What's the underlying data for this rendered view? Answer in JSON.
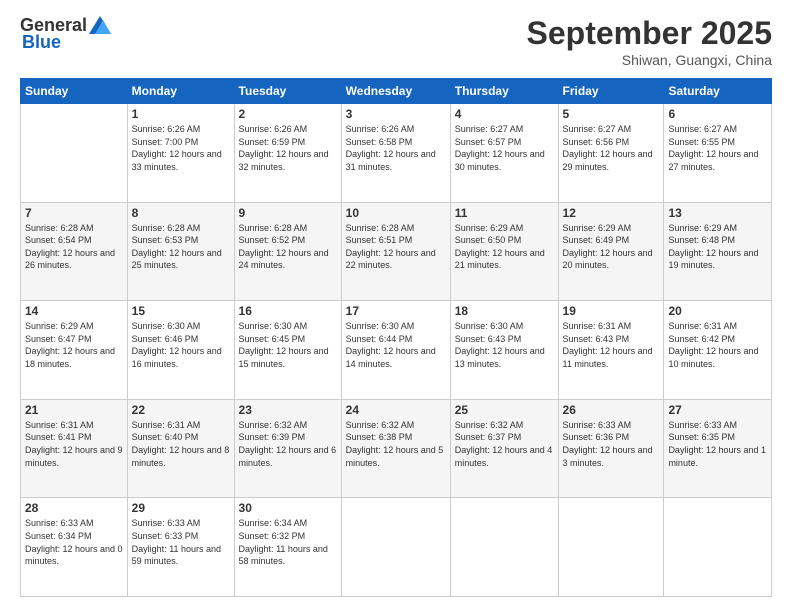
{
  "header": {
    "logo": {
      "text1": "General",
      "text2": "Blue"
    },
    "title": "September 2025",
    "location": "Shiwan, Guangxi, China"
  },
  "weekdays": [
    "Sunday",
    "Monday",
    "Tuesday",
    "Wednesday",
    "Thursday",
    "Friday",
    "Saturday"
  ],
  "weeks": [
    [
      {
        "day": "",
        "sunrise": "",
        "sunset": "",
        "daylight": ""
      },
      {
        "day": "1",
        "sunrise": "Sunrise: 6:26 AM",
        "sunset": "Sunset: 7:00 PM",
        "daylight": "Daylight: 12 hours and 33 minutes."
      },
      {
        "day": "2",
        "sunrise": "Sunrise: 6:26 AM",
        "sunset": "Sunset: 6:59 PM",
        "daylight": "Daylight: 12 hours and 32 minutes."
      },
      {
        "day": "3",
        "sunrise": "Sunrise: 6:26 AM",
        "sunset": "Sunset: 6:58 PM",
        "daylight": "Daylight: 12 hours and 31 minutes."
      },
      {
        "day": "4",
        "sunrise": "Sunrise: 6:27 AM",
        "sunset": "Sunset: 6:57 PM",
        "daylight": "Daylight: 12 hours and 30 minutes."
      },
      {
        "day": "5",
        "sunrise": "Sunrise: 6:27 AM",
        "sunset": "Sunset: 6:56 PM",
        "daylight": "Daylight: 12 hours and 29 minutes."
      },
      {
        "day": "6",
        "sunrise": "Sunrise: 6:27 AM",
        "sunset": "Sunset: 6:55 PM",
        "daylight": "Daylight: 12 hours and 27 minutes."
      }
    ],
    [
      {
        "day": "7",
        "sunrise": "Sunrise: 6:28 AM",
        "sunset": "Sunset: 6:54 PM",
        "daylight": "Daylight: 12 hours and 26 minutes."
      },
      {
        "day": "8",
        "sunrise": "Sunrise: 6:28 AM",
        "sunset": "Sunset: 6:53 PM",
        "daylight": "Daylight: 12 hours and 25 minutes."
      },
      {
        "day": "9",
        "sunrise": "Sunrise: 6:28 AM",
        "sunset": "Sunset: 6:52 PM",
        "daylight": "Daylight: 12 hours and 24 minutes."
      },
      {
        "day": "10",
        "sunrise": "Sunrise: 6:28 AM",
        "sunset": "Sunset: 6:51 PM",
        "daylight": "Daylight: 12 hours and 22 minutes."
      },
      {
        "day": "11",
        "sunrise": "Sunrise: 6:29 AM",
        "sunset": "Sunset: 6:50 PM",
        "daylight": "Daylight: 12 hours and 21 minutes."
      },
      {
        "day": "12",
        "sunrise": "Sunrise: 6:29 AM",
        "sunset": "Sunset: 6:49 PM",
        "daylight": "Daylight: 12 hours and 20 minutes."
      },
      {
        "day": "13",
        "sunrise": "Sunrise: 6:29 AM",
        "sunset": "Sunset: 6:48 PM",
        "daylight": "Daylight: 12 hours and 19 minutes."
      }
    ],
    [
      {
        "day": "14",
        "sunrise": "Sunrise: 6:29 AM",
        "sunset": "Sunset: 6:47 PM",
        "daylight": "Daylight: 12 hours and 18 minutes."
      },
      {
        "day": "15",
        "sunrise": "Sunrise: 6:30 AM",
        "sunset": "Sunset: 6:46 PM",
        "daylight": "Daylight: 12 hours and 16 minutes."
      },
      {
        "day": "16",
        "sunrise": "Sunrise: 6:30 AM",
        "sunset": "Sunset: 6:45 PM",
        "daylight": "Daylight: 12 hours and 15 minutes."
      },
      {
        "day": "17",
        "sunrise": "Sunrise: 6:30 AM",
        "sunset": "Sunset: 6:44 PM",
        "daylight": "Daylight: 12 hours and 14 minutes."
      },
      {
        "day": "18",
        "sunrise": "Sunrise: 6:30 AM",
        "sunset": "Sunset: 6:43 PM",
        "daylight": "Daylight: 12 hours and 13 minutes."
      },
      {
        "day": "19",
        "sunrise": "Sunrise: 6:31 AM",
        "sunset": "Sunset: 6:43 PM",
        "daylight": "Daylight: 12 hours and 11 minutes."
      },
      {
        "day": "20",
        "sunrise": "Sunrise: 6:31 AM",
        "sunset": "Sunset: 6:42 PM",
        "daylight": "Daylight: 12 hours and 10 minutes."
      }
    ],
    [
      {
        "day": "21",
        "sunrise": "Sunrise: 6:31 AM",
        "sunset": "Sunset: 6:41 PM",
        "daylight": "Daylight: 12 hours and 9 minutes."
      },
      {
        "day": "22",
        "sunrise": "Sunrise: 6:31 AM",
        "sunset": "Sunset: 6:40 PM",
        "daylight": "Daylight: 12 hours and 8 minutes."
      },
      {
        "day": "23",
        "sunrise": "Sunrise: 6:32 AM",
        "sunset": "Sunset: 6:39 PM",
        "daylight": "Daylight: 12 hours and 6 minutes."
      },
      {
        "day": "24",
        "sunrise": "Sunrise: 6:32 AM",
        "sunset": "Sunset: 6:38 PM",
        "daylight": "Daylight: 12 hours and 5 minutes."
      },
      {
        "day": "25",
        "sunrise": "Sunrise: 6:32 AM",
        "sunset": "Sunset: 6:37 PM",
        "daylight": "Daylight: 12 hours and 4 minutes."
      },
      {
        "day": "26",
        "sunrise": "Sunrise: 6:33 AM",
        "sunset": "Sunset: 6:36 PM",
        "daylight": "Daylight: 12 hours and 3 minutes."
      },
      {
        "day": "27",
        "sunrise": "Sunrise: 6:33 AM",
        "sunset": "Sunset: 6:35 PM",
        "daylight": "Daylight: 12 hours and 1 minute."
      }
    ],
    [
      {
        "day": "28",
        "sunrise": "Sunrise: 6:33 AM",
        "sunset": "Sunset: 6:34 PM",
        "daylight": "Daylight: 12 hours and 0 minutes."
      },
      {
        "day": "29",
        "sunrise": "Sunrise: 6:33 AM",
        "sunset": "Sunset: 6:33 PM",
        "daylight": "Daylight: 11 hours and 59 minutes."
      },
      {
        "day": "30",
        "sunrise": "Sunrise: 6:34 AM",
        "sunset": "Sunset: 6:32 PM",
        "daylight": "Daylight: 11 hours and 58 minutes."
      },
      {
        "day": "",
        "sunrise": "",
        "sunset": "",
        "daylight": ""
      },
      {
        "day": "",
        "sunrise": "",
        "sunset": "",
        "daylight": ""
      },
      {
        "day": "",
        "sunrise": "",
        "sunset": "",
        "daylight": ""
      },
      {
        "day": "",
        "sunrise": "",
        "sunset": "",
        "daylight": ""
      }
    ]
  ]
}
